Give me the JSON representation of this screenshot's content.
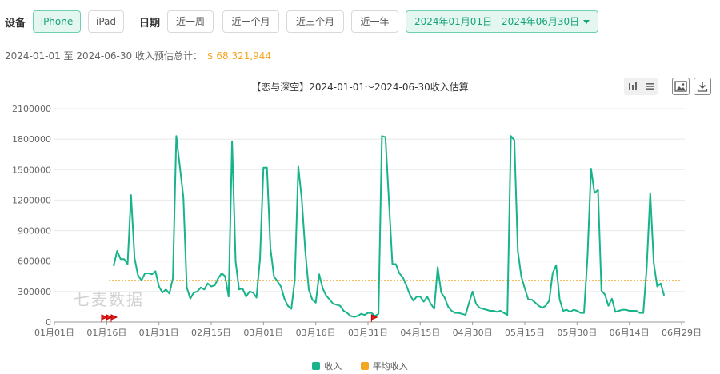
{
  "filters": {
    "device_label": "设备",
    "devices": [
      "iPhone",
      "iPad"
    ],
    "active_device": "iPhone",
    "date_label": "日期",
    "ranges": [
      "近一周",
      "近一个月",
      "近三个月",
      "近一年"
    ],
    "date_range": "2024年01月01日 - 2024年06月30日"
  },
  "summary": {
    "text": "2024-01-01 至 2024-06-30 收入预估总计：",
    "total": "$ 68,321,944"
  },
  "chart_title": "【恋与深空】2024-01-01～2024-06-30收入估算",
  "toolbar": {
    "icons": [
      "bar-chart-icon",
      "list-icon",
      "image-icon",
      "download-icon"
    ]
  },
  "watermark": "七麦数据",
  "colors": {
    "income": "#18b38a",
    "average": "#f5a623",
    "accent": "#18a37a"
  },
  "chart_data": {
    "type": "line",
    "title": "【恋与深空】2024-01-01～2024-06-30收入估算",
    "ylim": [
      0,
      2100000
    ],
    "yticks": [
      0,
      300000,
      600000,
      900000,
      1200000,
      1500000,
      1800000,
      2100000
    ],
    "xticks": [
      "01月01日",
      "01月16日",
      "01月31日",
      "02月15日",
      "03月01日",
      "03月16日",
      "03月31日",
      "04月15日",
      "04月30日",
      "05月15日",
      "05月30日",
      "06月14日",
      "06月29日"
    ],
    "legend_position": "bottom",
    "start_date": "2024-01-18",
    "series": [
      {
        "name": "收入",
        "values": [
          550000,
          700000,
          620000,
          620000,
          570000,
          1250000,
          630000,
          460000,
          410000,
          480000,
          480000,
          470000,
          500000,
          350000,
          290000,
          320000,
          280000,
          430000,
          1830000,
          1530000,
          1230000,
          340000,
          230000,
          290000,
          300000,
          340000,
          320000,
          380000,
          350000,
          360000,
          430000,
          480000,
          450000,
          250000,
          1780000,
          600000,
          320000,
          330000,
          250000,
          300000,
          290000,
          240000,
          620000,
          1520000,
          1520000,
          730000,
          450000,
          400000,
          350000,
          230000,
          160000,
          130000,
          420000,
          1530000,
          1210000,
          700000,
          320000,
          220000,
          190000,
          470000,
          330000,
          260000,
          220000,
          180000,
          170000,
          160000,
          110000,
          90000,
          60000,
          50000,
          60000,
          80000,
          70000,
          90000,
          90000,
          60000,
          80000,
          1830000,
          1820000,
          1200000,
          570000,
          570000,
          480000,
          440000,
          360000,
          270000,
          210000,
          250000,
          250000,
          200000,
          250000,
          180000,
          130000,
          540000,
          290000,
          240000,
          150000,
          110000,
          90000,
          90000,
          80000,
          70000,
          190000,
          300000,
          180000,
          140000,
          130000,
          120000,
          110000,
          110000,
          100000,
          110000,
          90000,
          70000,
          1830000,
          1790000,
          700000,
          450000,
          330000,
          220000,
          220000,
          190000,
          160000,
          140000,
          160000,
          210000,
          480000,
          560000,
          220000,
          110000,
          120000,
          100000,
          120000,
          110000,
          90000,
          90000,
          650000,
          1510000,
          1270000,
          1300000,
          310000,
          270000,
          160000,
          230000,
          100000,
          110000,
          120000,
          120000,
          110000,
          110000,
          110000,
          90000,
          90000,
          540000,
          1270000,
          580000,
          350000,
          380000,
          260000
        ]
      },
      {
        "name": "平均收入",
        "value": 410000
      }
    ]
  }
}
